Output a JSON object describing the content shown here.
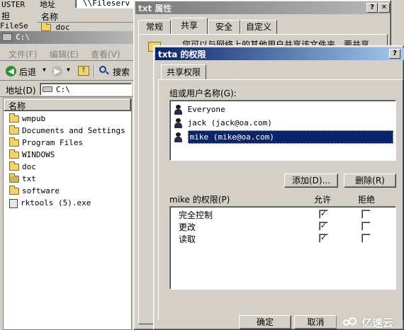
{
  "bg_window": {
    "title_fragments": [
      "USTER",
      "担",
      "FileSe"
    ],
    "address_label": "地址",
    "address_value": "\\\\Fileserv",
    "header_name": "名称",
    "partial_item": "doc"
  },
  "explorer": {
    "title": "C:\\",
    "menu": [
      "文件(F)",
      "编辑(E)",
      "查看(V)"
    ],
    "toolbar": {
      "back": "后退",
      "search": "搜索"
    },
    "address_label": "地址(D)",
    "address_value": "C:\\",
    "column_header": "名称",
    "items": [
      {
        "label": "wmpub",
        "icon": "folder-icon"
      },
      {
        "label": "Documents and Settings",
        "icon": "folder-icon"
      },
      {
        "label": "Program Files",
        "icon": "folder-icon"
      },
      {
        "label": "WINDOWS",
        "icon": "folder-icon"
      },
      {
        "label": "doc",
        "icon": "folder-icon"
      },
      {
        "label": "txt",
        "icon": "shared-folder-icon"
      },
      {
        "label": "software",
        "icon": "folder-icon"
      },
      {
        "label": "rktools (5).exe",
        "icon": "exe-icon"
      }
    ]
  },
  "properties": {
    "title": "txt 属性",
    "tabs": [
      "常规",
      "共享",
      "安全",
      "自定义"
    ],
    "active_tab": "共享",
    "description": "您可以与网络上的其他用户共享该文件夹。要共享"
  },
  "permissions": {
    "title": "txta 的权限",
    "tab": "共享权限",
    "group_label": "组或用户名称(G):",
    "users": [
      {
        "label": "Everyone",
        "selected": false
      },
      {
        "label": "jack (jack@oa.com)",
        "selected": false
      },
      {
        "label": "mike (mike@oa.com)",
        "selected": true
      }
    ],
    "add_button": "添加(D)...",
    "remove_button": "删除(R)",
    "perm_label": "mike 的权限(P)",
    "allow_header": "允许",
    "deny_header": "拒绝",
    "perms": [
      {
        "label": "完全控制",
        "allow": true,
        "deny": false
      },
      {
        "label": "更改",
        "allow": true,
        "deny": false
      },
      {
        "label": "读取",
        "allow": true,
        "deny": false
      }
    ],
    "ok_button": "确定",
    "cancel_button": "取消"
  },
  "watermark": "亿速云"
}
